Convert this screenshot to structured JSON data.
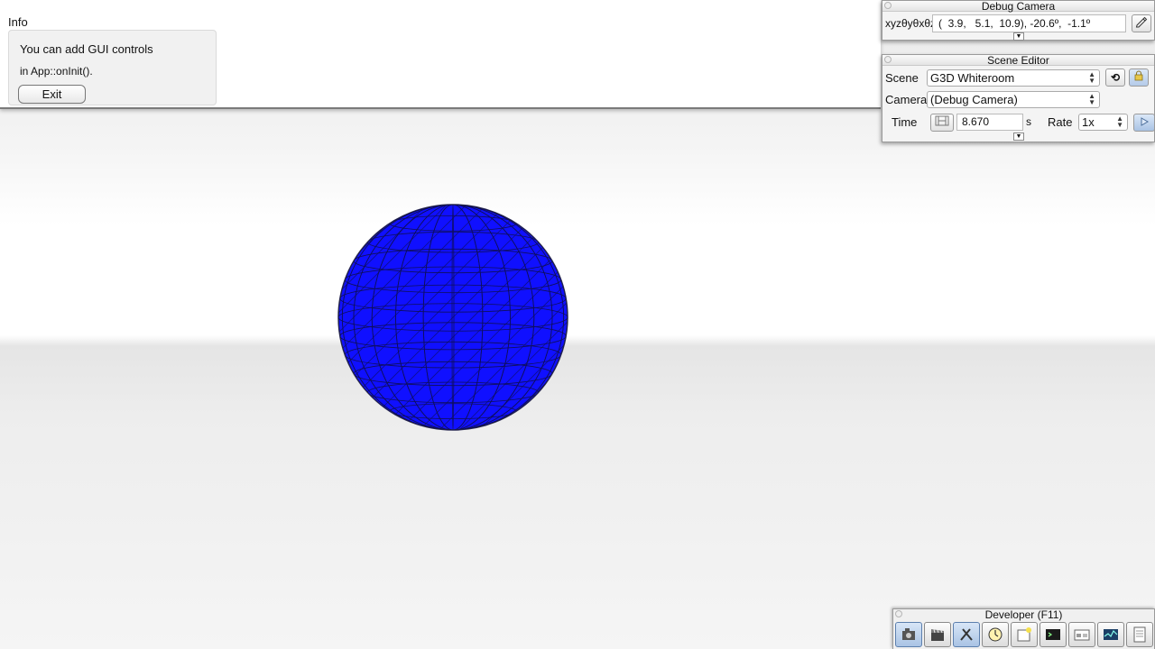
{
  "info": {
    "title": "Info",
    "line1": "You can add GUI controls",
    "line2": "in App::onInit().",
    "exit_label": "Exit"
  },
  "debug_camera": {
    "title": "Debug Camera",
    "coord_label": "xyzθyθxθz",
    "coord_value": "(  3.9,   5.1,  10.9), -20.6º,  -1.1º",
    "link_icon": "pencil-icon"
  },
  "scene_editor": {
    "title": "Scene Editor",
    "scene_label": "Scene",
    "scene_value": "G3D Whiteroom",
    "camera_label": "Camera",
    "camera_value": "(Debug Camera)",
    "time_label": "Time",
    "time_value": "8.670",
    "time_unit": "s",
    "rate_label": "Rate",
    "rate_value": "1x",
    "reload_icon": "reload-icon",
    "lock_icon": "lock-icon",
    "play_icon": "play-icon"
  },
  "developer": {
    "title": "Developer (F11)",
    "tools": [
      {
        "icon": "camera-icon",
        "active": true
      },
      {
        "icon": "film-clapper-icon",
        "active": false
      },
      {
        "icon": "tools-icon",
        "active": true
      },
      {
        "icon": "profiler-clock-icon",
        "active": false
      },
      {
        "icon": "new-window-icon",
        "active": false
      },
      {
        "icon": "console-icon",
        "active": false
      },
      {
        "icon": "scene-graph-icon",
        "active": false
      },
      {
        "icon": "performance-graph-icon",
        "active": false
      },
      {
        "icon": "log-document-icon",
        "active": false
      }
    ]
  },
  "colors": {
    "sphere": "#1010ff",
    "active_tool": "#a9c3e4"
  }
}
